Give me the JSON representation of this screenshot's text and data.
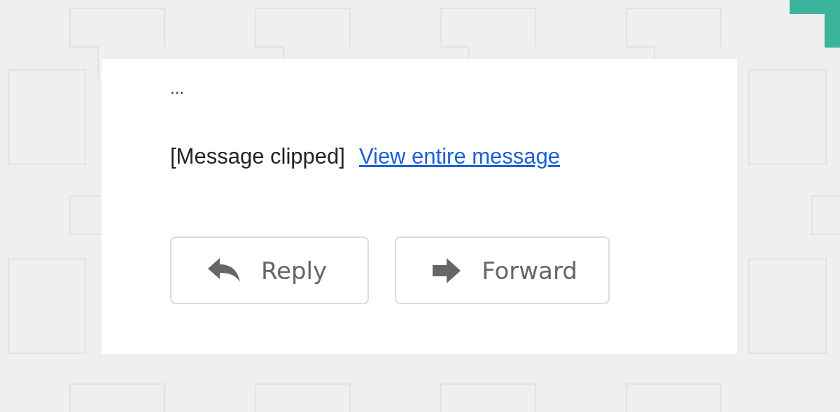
{
  "message": {
    "ellipsis": "...",
    "clipped_note": "[Message clipped]",
    "link": "View entire message"
  },
  "buttons": [
    {
      "kind": "reply",
      "label": "Reply"
    },
    {
      "kind": "forward",
      "label": "Forward"
    }
  ]
}
